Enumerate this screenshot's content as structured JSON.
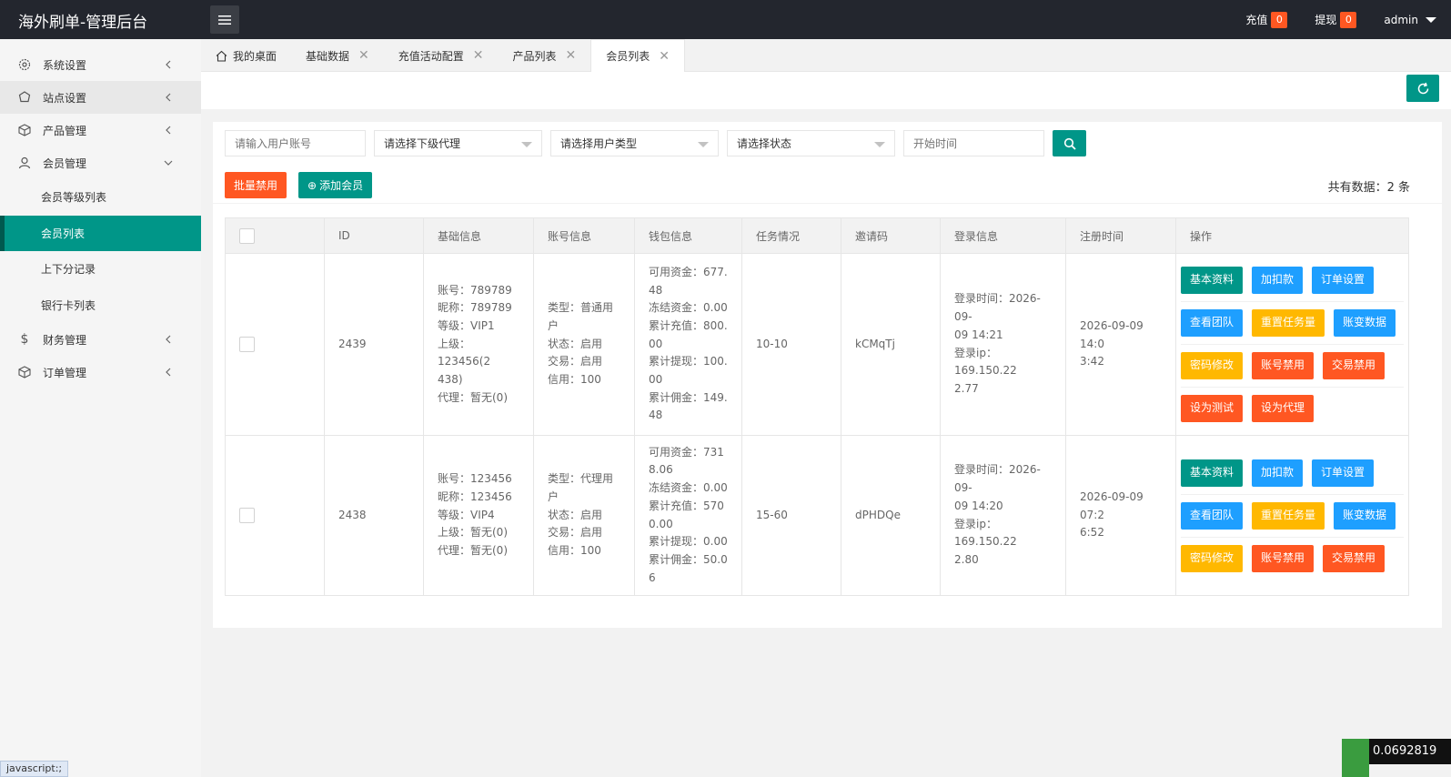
{
  "header": {
    "title": "海外刷单-管理后台",
    "recharge_label": "充值",
    "recharge_count": "0",
    "withdraw_label": "提现",
    "withdraw_count": "0",
    "user": "admin"
  },
  "sidebar": {
    "items": [
      {
        "label": "系统设置",
        "icon": "gear-icon"
      },
      {
        "label": "站点设置",
        "icon": "site-icon"
      },
      {
        "label": "产品管理",
        "icon": "box-icon"
      },
      {
        "label": "会员管理",
        "icon": "user-icon"
      }
    ],
    "sub_items": [
      "会员等级列表",
      "会员列表",
      "上下分记录",
      "银行卡列表"
    ],
    "items_after": [
      {
        "label": "财务管理",
        "icon": "dollar-icon"
      },
      {
        "label": "订单管理",
        "icon": "box-icon"
      }
    ]
  },
  "tabs": [
    "我的桌面",
    "基础数据",
    "充值活动配置",
    "产品列表",
    "会员列表"
  ],
  "search": {
    "account_placeholder": "请输入用户账号",
    "agent_select": "请选择下级代理",
    "type_select": "请选择用户类型",
    "status_select": "请选择状态",
    "start_time_placeholder": "开始时间"
  },
  "actions": {
    "batch_disable": "批量禁用",
    "add_member": "添加会员",
    "total": "共有数据：2 条"
  },
  "table": {
    "headers": [
      "ID",
      "基础信息",
      "账号信息",
      "钱包信息",
      "任务情况",
      "邀请码",
      "登录信息",
      "注册时间",
      "操作"
    ],
    "rows": [
      {
        "id": "2439",
        "basic": [
          "账号：789789",
          "昵称：789789",
          "等级：VIP1",
          "上级：123456(2",
          "438)",
          "代理：暂无(0)"
        ],
        "account": [
          "类型：普通用",
          "户",
          "状态：启用",
          "交易：启用",
          "信用：100"
        ],
        "wallet": [
          "可用资金：677.",
          "48",
          "冻结资金：0.00",
          "累计充值：800.",
          "00",
          "累计提现：100.",
          "00",
          "累计佣金：149.",
          "48"
        ],
        "task": "10-10",
        "invite": "kCMqTj",
        "login": [
          "登录时间：2026-09-",
          "09 14:21",
          "登录ip：169.150.22",
          "2.77"
        ],
        "register": [
          "2026-09-09 14:0",
          "3:42"
        ],
        "ops": [
          [
            {
              "label": "基本资料",
              "color": "green"
            },
            {
              "label": "加扣款",
              "color": "blue"
            },
            {
              "label": "订单设置",
              "color": "blue"
            }
          ],
          [
            {
              "label": "查看团队",
              "color": "blue"
            },
            {
              "label": "重置任务量",
              "color": "yellow"
            },
            {
              "label": "账变数据",
              "color": "blue"
            }
          ],
          [
            {
              "label": "密码修改",
              "color": "yellow"
            },
            {
              "label": "账号禁用",
              "color": "red"
            },
            {
              "label": "交易禁用",
              "color": "red"
            }
          ],
          [
            {
              "label": "设为测试",
              "color": "red"
            },
            {
              "label": "设为代理",
              "color": "red"
            }
          ]
        ]
      },
      {
        "id": "2438",
        "basic": [
          "账号：123456",
          "昵称：123456",
          "等级：VIP4",
          "上级：暂无(0)",
          "代理：暂无(0)"
        ],
        "account": [
          "类型：代理用",
          "户",
          "状态：启用",
          "交易：启用",
          "信用：100"
        ],
        "wallet": [
          "可用资金：731",
          "8.06",
          "冻结资金：0.00",
          "累计充值：570",
          "0.00",
          "累计提现：0.00",
          "累计佣金：50.0",
          "6"
        ],
        "task": "15-60",
        "invite": "dPHDQe",
        "login": [
          "登录时间：2026-09-",
          "09 14:20",
          "登录ip：169.150.22",
          "2.80"
        ],
        "register": [
          "2026-09-09 07:2",
          "6:52"
        ],
        "ops": [
          [
            {
              "label": "基本资料",
              "color": "green"
            },
            {
              "label": "加扣款",
              "color": "blue"
            },
            {
              "label": "订单设置",
              "color": "blue"
            }
          ],
          [
            {
              "label": "查看团队",
              "color": "blue"
            },
            {
              "label": "重置任务量",
              "color": "yellow"
            },
            {
              "label": "账变数据",
              "color": "blue"
            }
          ],
          [
            {
              "label": "密码修改",
              "color": "yellow"
            },
            {
              "label": "账号禁用",
              "color": "red"
            },
            {
              "label": "交易禁用",
              "color": "red"
            }
          ]
        ]
      }
    ]
  },
  "statusbar": "javascript:;",
  "corner_value": "0.0692819",
  "colors": {
    "primary": "#009688",
    "danger": "#ff5722",
    "info": "#1e9fff",
    "warn": "#ffb800",
    "header": "#23262e"
  }
}
